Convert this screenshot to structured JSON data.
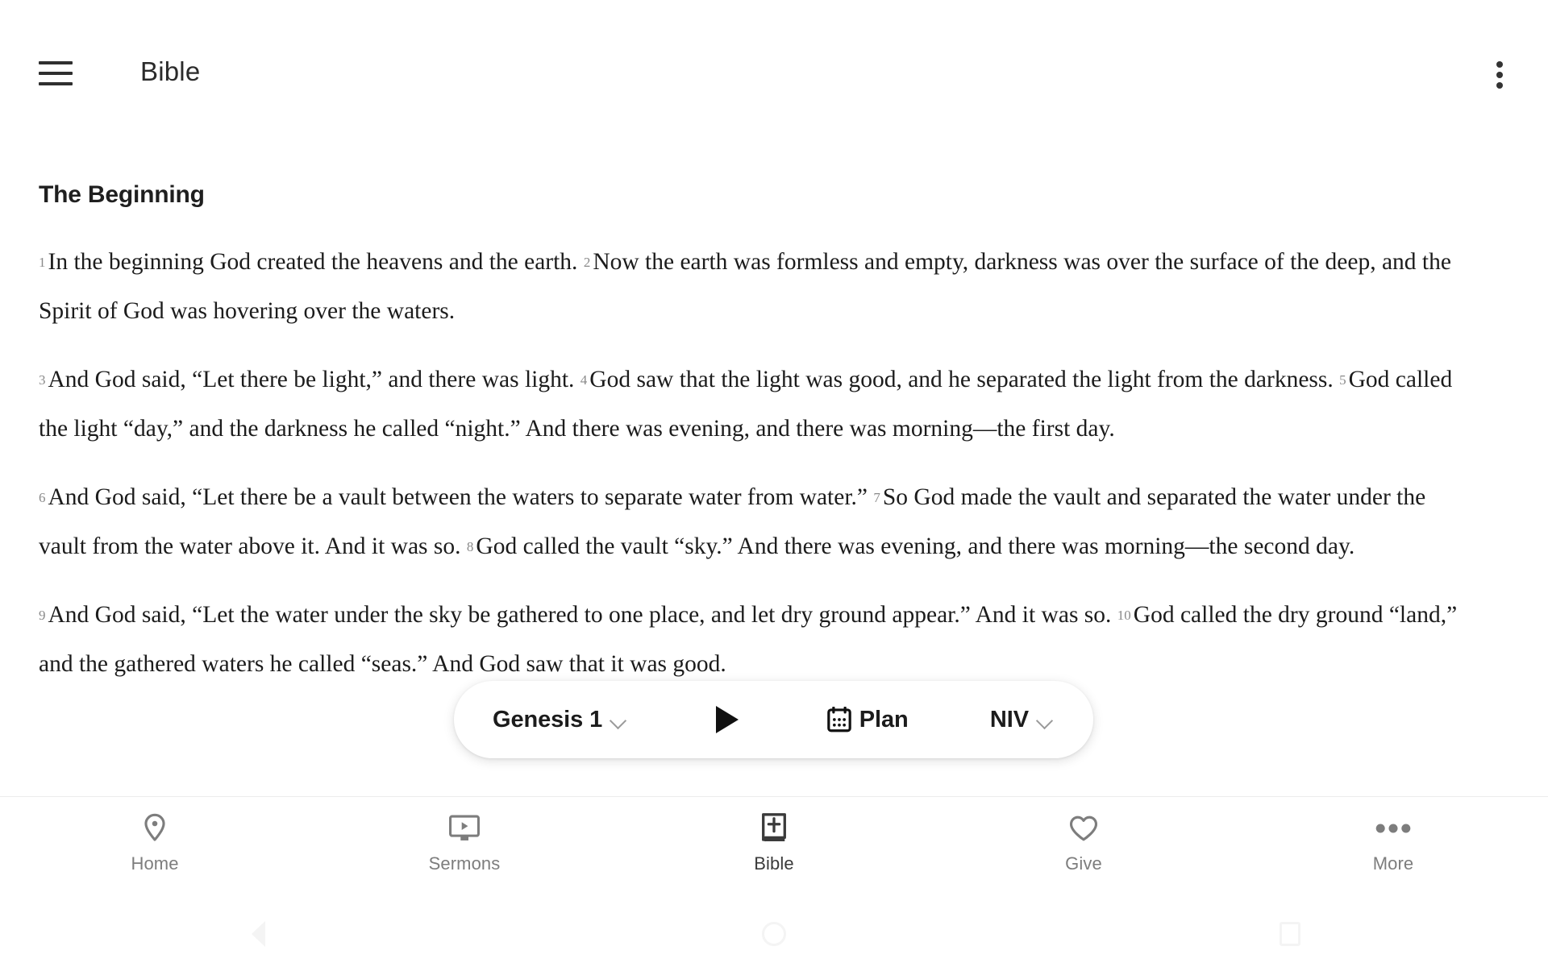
{
  "app_bar": {
    "menu_icon": "hamburger-menu-icon",
    "title": "Bible",
    "overflow_icon": "more-vertical-icon"
  },
  "scripture": {
    "heading": "The Beginning",
    "paragraphs": [
      {
        "verses": [
          {
            "num": "1",
            "text": "In the beginning God created the heavens and the earth."
          },
          {
            "num": "2",
            "text": "Now the earth was formless and empty, darkness was over the surface of the deep, and the Spirit of God was hovering over the waters."
          }
        ]
      },
      {
        "verses": [
          {
            "num": "3",
            "text": "And God said, “Let there be light,” and there was light."
          },
          {
            "num": "4",
            "text": "God saw that the light was good, and he separated the light from the darkness."
          },
          {
            "num": "5",
            "text": "God called the light “day,” and the darkness he called “night.” And there was evening, and there was morning—the first day."
          }
        ]
      },
      {
        "verses": [
          {
            "num": "6",
            "text": "And God said, “Let there be a vault between the waters to separate water from water.”"
          },
          {
            "num": "7",
            "text": "So God made the vault and separated the water under the vault from the water above it. And it was so."
          },
          {
            "num": "8",
            "text": "God called the vault “sky.” And there was evening, and there was morning—the second day."
          }
        ]
      },
      {
        "verses": [
          {
            "num": "9",
            "text": "And God said, “Let the water under the sky be gathered to one place, and let dry ground appear.” And it was so."
          },
          {
            "num": "10",
            "text": "God called the dry ground “land,” and the gathered waters he called “seas.” And God saw that it was good."
          }
        ]
      }
    ]
  },
  "reader_pill": {
    "reference_label": "Genesis 1",
    "reference_chevron_icon": "chevron-down-icon",
    "play_icon": "play-icon",
    "plan_icon": "calendar-icon",
    "plan_label": "Plan",
    "version_label": "NIV",
    "version_chevron_icon": "chevron-down-icon"
  },
  "bottom_nav": {
    "items": [
      {
        "icon": "location-pin-icon",
        "label": "Home",
        "active": false
      },
      {
        "icon": "video-monitor-icon",
        "label": "Sermons",
        "active": false
      },
      {
        "icon": "bible-book-icon",
        "label": "Bible",
        "active": true
      },
      {
        "icon": "heart-icon",
        "label": "Give",
        "active": false
      },
      {
        "icon": "more-horizontal-icon",
        "label": "More",
        "active": false
      }
    ]
  },
  "system_nav": {
    "back_icon": "android-back-icon",
    "home_icon": "android-home-icon",
    "recents_icon": "android-recents-icon"
  },
  "colors": {
    "background": "#ffffff",
    "text_primary": "#1c1c1c",
    "verse_number": "#8a8a8a",
    "nav_inactive": "#7d7d7d",
    "nav_active": "#3b3b3b",
    "divider": "#ececec"
  }
}
